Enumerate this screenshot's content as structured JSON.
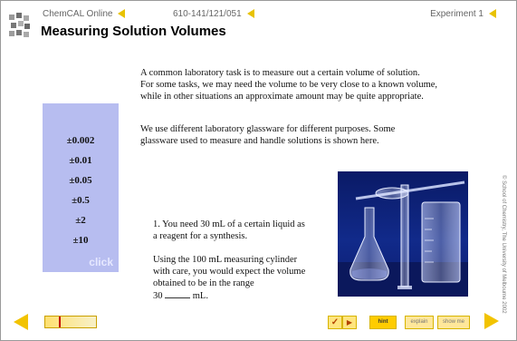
{
  "header": {
    "brand": "ChemCAL Online",
    "course": "610-141/121/051",
    "experiment": "Experiment 1",
    "title": "Measuring Solution Volumes"
  },
  "intro": {
    "p1": [
      "A common laboratory task is to measure out a certain volume of solution.",
      "For some tasks, we may need the volume to be very close to a known volume,",
      "while in other situations an approximate amount may be quite appropriate."
    ],
    "p2": [
      "We use different laboratory glassware for different purposes.  Some",
      "glassware used to measure and handle solutions is shown here."
    ]
  },
  "panel": {
    "values": [
      "±0.002",
      "±0.01",
      "±0.05",
      "±0.5",
      "±2",
      "±10"
    ],
    "click_label": "click"
  },
  "question": {
    "q1": [
      "1.  You need 30 mL of a certain liquid as",
      "a reagent for a synthesis."
    ],
    "q2": [
      "Using the 100 mL measuring cylinder",
      "with care, you would expect the volume",
      "obtained to be in the range"
    ],
    "answer_prefix": "30",
    "answer_suffix": "mL."
  },
  "copyright": "© School of Chemistry, The University of Melbourne 2002",
  "footer": {
    "hint": "hint",
    "explain": "explain",
    "show_me": "show me",
    "check_icon": "check-icon",
    "progress_value": 0.27
  },
  "colors": {
    "accent": "#f2c300",
    "panel": "#b7bdf0",
    "photo_bg": "#0a1a66"
  }
}
